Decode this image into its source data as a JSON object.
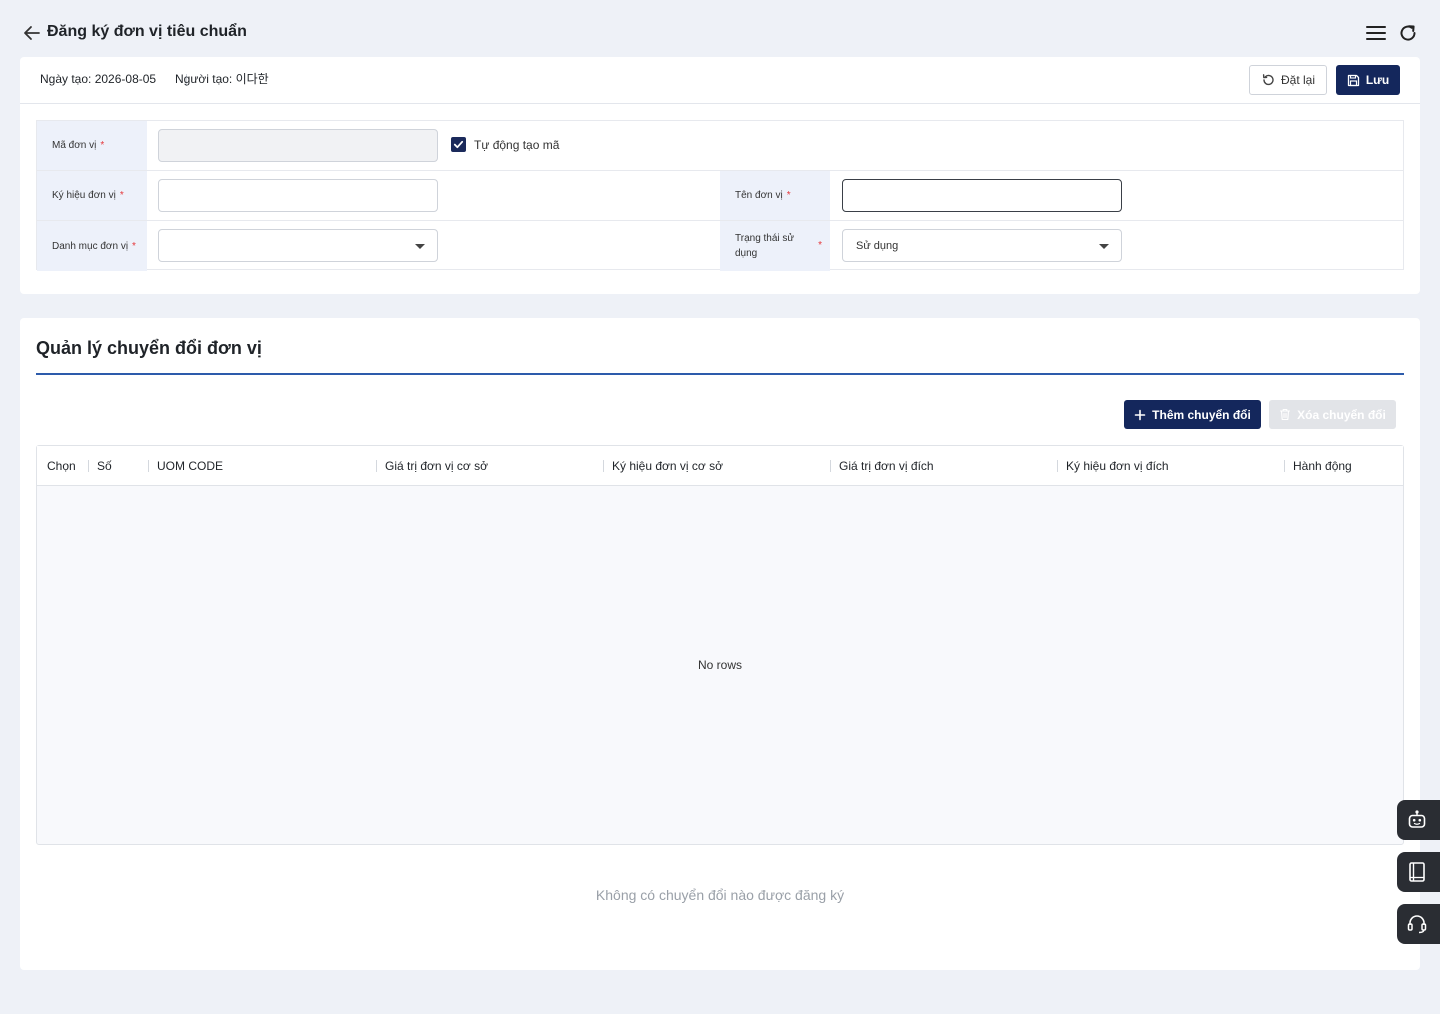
{
  "header": {
    "title": "Đăng ký đơn vị tiêu chuẩn"
  },
  "meta": {
    "created_date": "Ngày tạo: 2026-08-05",
    "creator": "Người tạo: 이다한"
  },
  "toolbar": {
    "reset_label": "Đặt lại",
    "save_label": "Lưu"
  },
  "form": {
    "code_label": "Mã đơn vị",
    "code_value": "",
    "auto_code_label": "Tự động tạo mã",
    "auto_code_checked": true,
    "symbol_label": "Ký hiệu đơn vị",
    "symbol_value": "",
    "name_label": "Tên đơn vị",
    "name_value": "",
    "category_label": "Danh mục đơn vị",
    "category_value": "",
    "status_label": "Trạng thái sử dụng",
    "status_value": "Sử dụng",
    "required_mark": "*"
  },
  "conversion": {
    "title": "Quản lý chuyển đổi đơn vị",
    "add_label": "Thêm chuyển đổi",
    "delete_label": "Xóa chuyển đổi",
    "columns": [
      "Chọn",
      "Số",
      "UOM CODE",
      "Giá trị đơn vị cơ sở",
      "Ký hiệu đơn vị cơ sở",
      "Giá trị đơn vị đích",
      "Ký hiệu đơn vị đích",
      "Hành động"
    ],
    "no_rows": "No rows",
    "empty_note": "Không có chuyển đổi nào được đăng ký"
  },
  "side_buttons": [
    "chatbot-icon",
    "manual-book-icon",
    "support-headset-icon"
  ],
  "colors": {
    "primary": "#14275c",
    "accent_line": "#2d5bab",
    "label_bg": "#edf1fa",
    "required": "#e5383b",
    "page_bg": "#eef1f7"
  }
}
